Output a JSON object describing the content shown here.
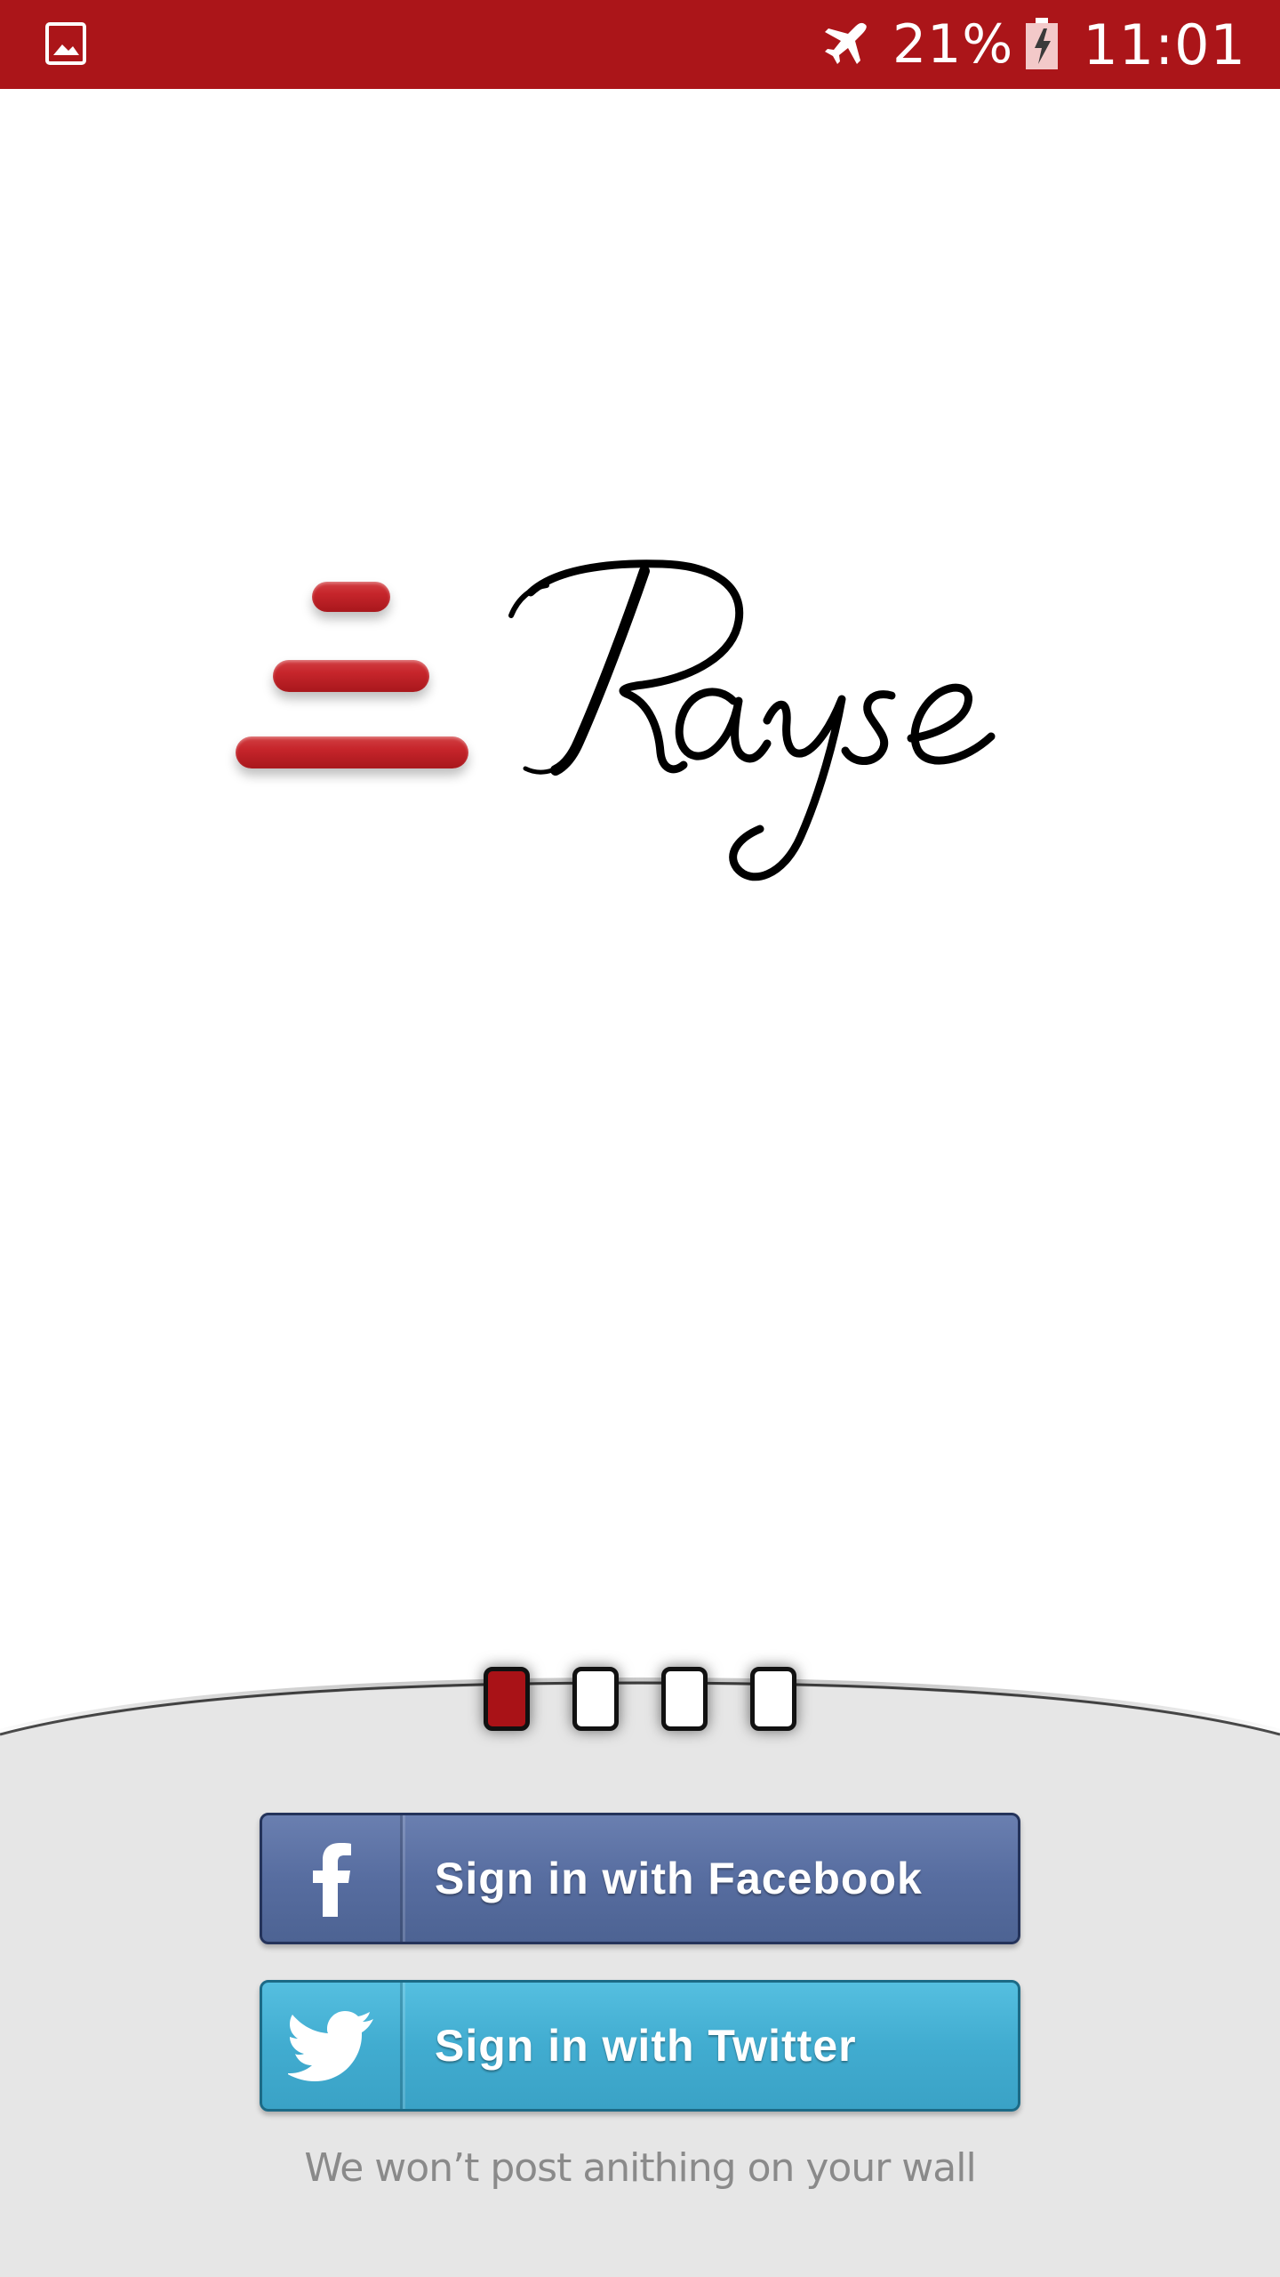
{
  "status_bar": {
    "battery_percent": "21%",
    "time": "11:01",
    "background_color": "#ab1519",
    "icons": [
      "gallery-notification-icon",
      "airplane-mode-icon",
      "battery-charging-icon"
    ]
  },
  "logo": {
    "wordmark": "Rayse",
    "bar_color": "#c1272d"
  },
  "pager": {
    "pages": 4,
    "active_index": 0,
    "active_color": "#a91217"
  },
  "buttons": {
    "facebook": {
      "label": "Sign in with Facebook",
      "icon": "facebook-icon",
      "color": "#576da0"
    },
    "twitter": {
      "label": "Sign in with Twitter",
      "icon": "twitter-bird-icon",
      "color": "#41acd0"
    }
  },
  "disclaimer": "We won’t post anithing on your wall"
}
